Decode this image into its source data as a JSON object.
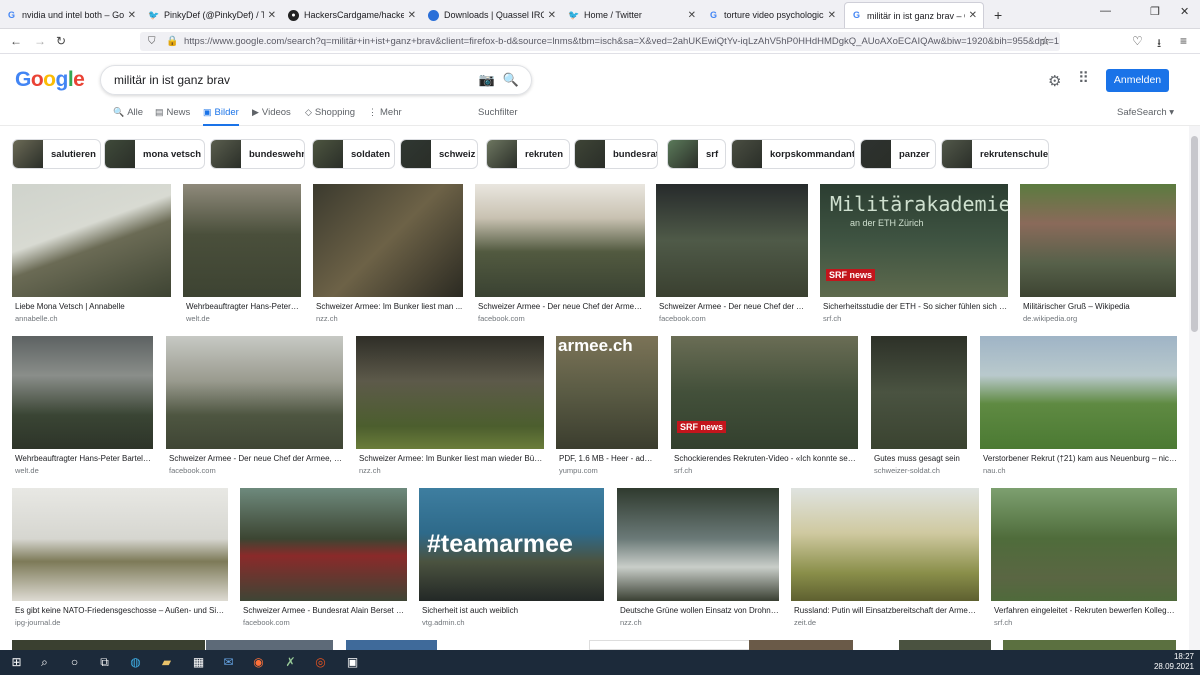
{
  "browser": {
    "tabs": [
      {
        "title": "nvidia und intel both – Google",
        "favicon": "G"
      },
      {
        "title": "PinkyDef (@PinkyDef) / Twitter",
        "favicon": "twitter-bird"
      },
      {
        "title": "HackersCardgame/hackerscard",
        "favicon": "github"
      },
      {
        "title": "Downloads | Quassel IRC",
        "favicon": "quassel"
      },
      {
        "title": "Home / Twitter",
        "favicon": "twitter-bird"
      },
      {
        "title": "torture video psychological wa",
        "favicon": "G"
      },
      {
        "title": "militär in ist ganz brav – Google",
        "favicon": "G"
      }
    ],
    "new_tab_symbol": "+",
    "url": "https://www.google.com/search?q=militär+in+ist+ganz+brav&client=firefox-b-d&source=lnms&tbm=isch&sa=X&ved=2ahUKEwiQtYv-iqLzAhV5hP0HHdHMDgkQ_AUoAXoECAIQAw&biw=1920&bih=955&dpr=1"
  },
  "google": {
    "logo": "Google",
    "query": "militär in ist ganz brav",
    "signin_label": "Anmelden",
    "nav": {
      "alle": "Alle",
      "news": "News",
      "bilder": "Bilder",
      "videos": "Videos",
      "shopping": "Shopping",
      "mehr": "Mehr",
      "suchfilter": "Suchfilter",
      "safesearch": "SafeSearch ▾"
    },
    "chips": [
      "salutieren",
      "mona vetsch",
      "bundeswehr",
      "soldaten",
      "schweiz",
      "rekruten",
      "bundesrat",
      "srf",
      "korpskommandant",
      "panzer",
      "rekrutenschule"
    ]
  },
  "results": [
    {
      "caption": "Liebe Mona Vetsch | Annabelle",
      "source": "annabelle.ch"
    },
    {
      "caption": "Wehrbeauftragter Hans-Peter Bartels ...",
      "source": "welt.de"
    },
    {
      "caption": "Schweizer Armee: Im Bunker liest man ...",
      "source": "nzz.ch"
    },
    {
      "caption": "Schweizer Armee - Der neue Chef der Armee, ...",
      "source": "facebook.com"
    },
    {
      "caption": "Schweizer Armee - Der neue Chef der Armee ...",
      "source": "facebook.com"
    },
    {
      "caption": "Sicherheitsstudie der ETH - So sicher fühlen sich die ...",
      "source": "srf.ch",
      "overlay": "Militärakademie",
      "overlay2": "an der ETH Zürich",
      "badge": "SRF news"
    },
    {
      "caption": "Militärischer Gruß – Wikipedia",
      "source": "de.wikipedia.org"
    },
    {
      "caption": "Wehrbeauftragter Hans-Peter Bartels: ...",
      "source": "welt.de"
    },
    {
      "caption": "Schweizer Armee - Der neue Chef der Armee, Ko...",
      "source": "facebook.com"
    },
    {
      "caption": "Schweizer Armee: Im Bunker liest man wieder Büch...",
      "source": "nzz.ch"
    },
    {
      "caption": "PDF, 1.6 MB - Heer - admin...",
      "source": "yumpu.com",
      "overlay": "armee.ch"
    },
    {
      "caption": "Schockierendes Rekruten-Video - «Ich konnte sehe...",
      "source": "srf.ch",
      "badge": "SRF news"
    },
    {
      "caption": "Gutes muss gesagt sein",
      "source": "schweizer-soldat.ch"
    },
    {
      "caption": "Verstorbener Rekrut (†21) kam aus Neuenburg – nicht...",
      "source": "nau.ch"
    },
    {
      "caption": "Es gibt keine NATO-Friedensgeschosse – Außen- und Siche...",
      "source": "ipg-journal.de"
    },
    {
      "caption": "Schweizer Armee - Bundesrat Alain Berset un...",
      "source": "facebook.com"
    },
    {
      "caption": "Sicherheit ist auch weiblich",
      "source": "vtg.admin.ch",
      "overlay": "#teamarmee"
    },
    {
      "caption": "Deutsche Grüne wollen Einsatz von Drohnen...",
      "source": "nzz.ch"
    },
    {
      "caption": "Russland: Putin will Einsatzbereitschaft der Armee ...",
      "source": "zeit.de"
    },
    {
      "caption": "Verfahren eingeleitet - Rekruten bewerfen Kollegen...",
      "source": "srf.ch"
    }
  ],
  "taskbar": {
    "time": "18:27",
    "date": "28.09.2021"
  },
  "colors": {
    "accent": "#1a73e8",
    "google_blue": "#4285f4",
    "google_red": "#ea4335",
    "google_yellow": "#fbbc05",
    "google_green": "#34a853"
  }
}
